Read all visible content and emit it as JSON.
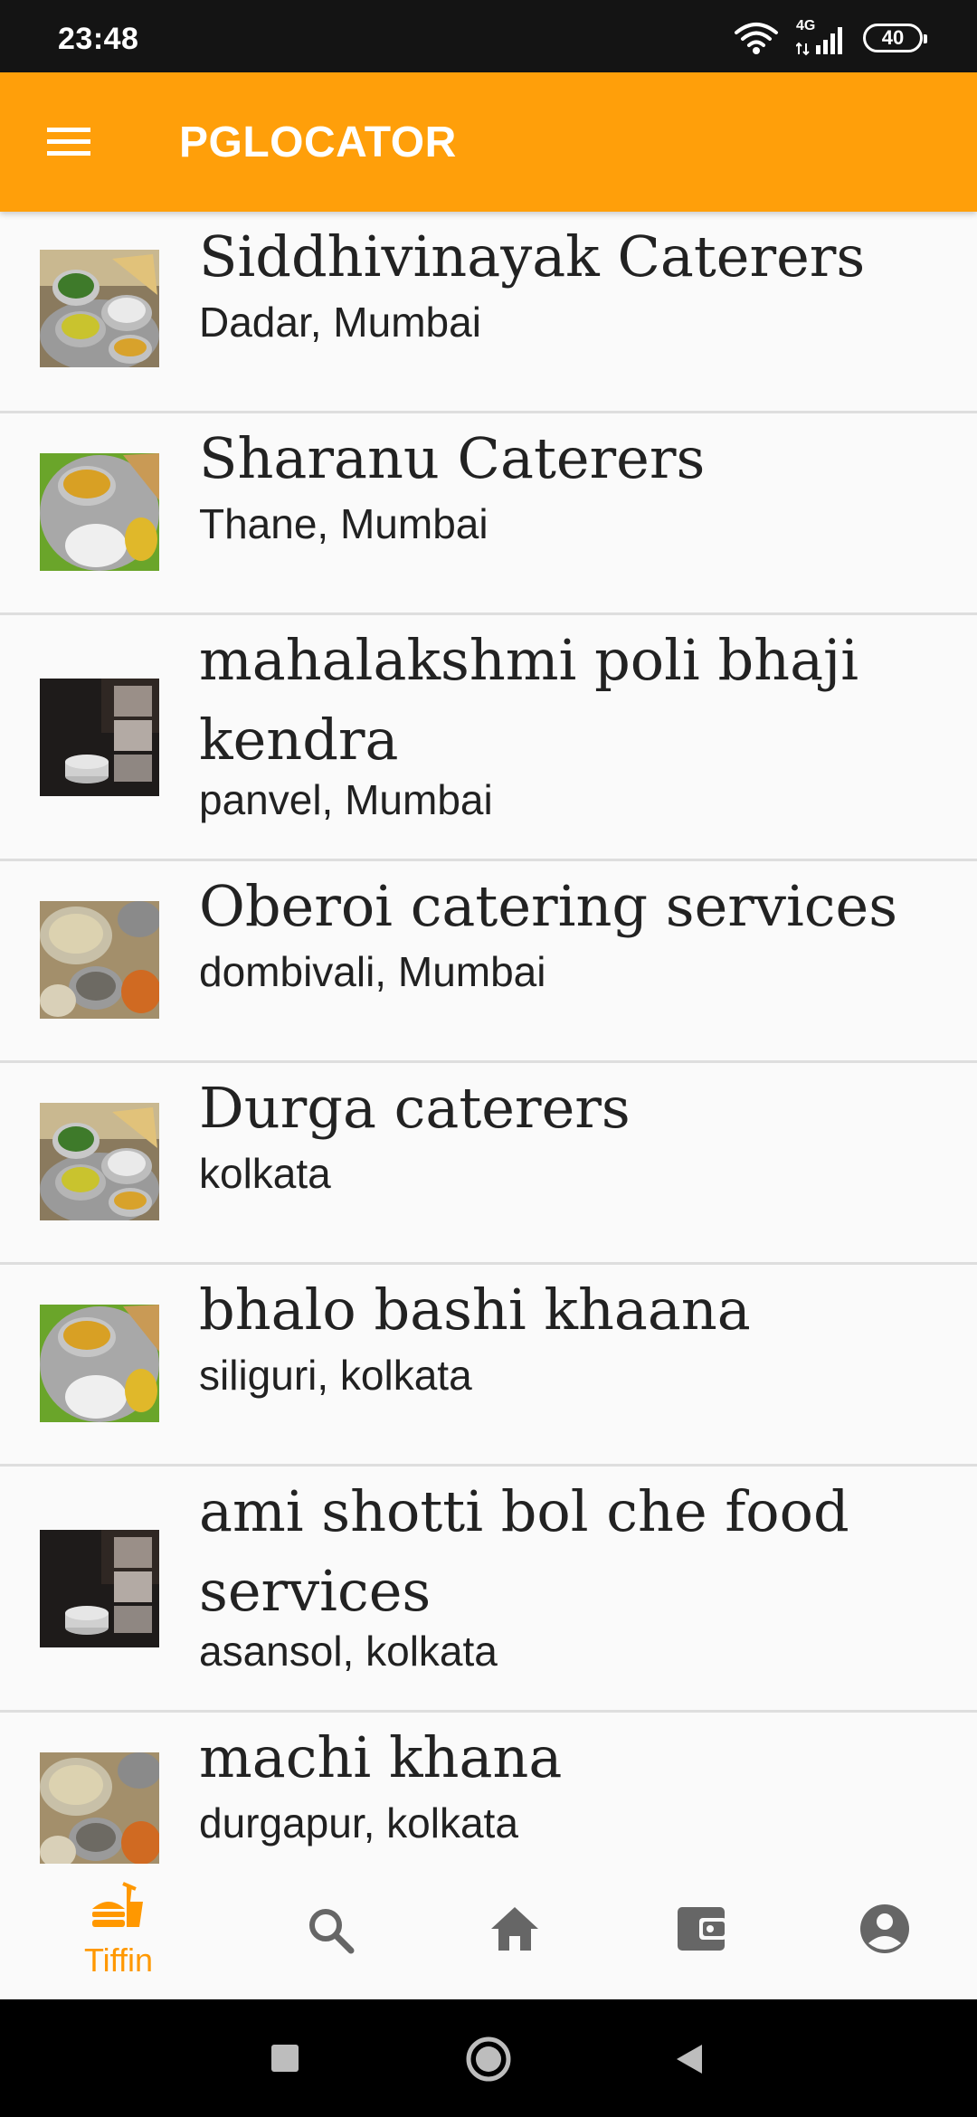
{
  "status_bar": {
    "time": "23:48",
    "network": "4G",
    "battery": "40"
  },
  "app_bar": {
    "title": "PGLOCATOR",
    "menu_icon": "hamburger-menu-icon"
  },
  "list": {
    "items": [
      {
        "name": "Siddhivinayak Caterers",
        "location": "Dadar, Mumbai",
        "thumbnail": "thali-plate"
      },
      {
        "name": "Sharanu Caterers",
        "location": "Thane, Mumbai",
        "thumbnail": "dal-rice-plate"
      },
      {
        "name": "mahalakshmi poli bhaji kendra",
        "location": "panvel, Mumbai",
        "thumbnail": "steel-tiffin"
      },
      {
        "name": "Oberoi catering services",
        "location": "dombivali, Mumbai",
        "thumbnail": "bowls-curry"
      },
      {
        "name": "Durga caterers",
        "location": "kolkata",
        "thumbnail": "thali-plate"
      },
      {
        "name": "bhalo bashi khaana",
        "location": "siliguri, kolkata",
        "thumbnail": "dal-rice-plate"
      },
      {
        "name": "ami shotti bol che food services",
        "location": "asansol, kolkata",
        "thumbnail": "steel-tiffin"
      },
      {
        "name": "machi khana",
        "location": "durgapur, kolkata",
        "thumbnail": "bowls-curry"
      }
    ]
  },
  "bottom_nav": {
    "items": [
      {
        "label": "Tiffin",
        "icon": "tiffin-burger-icon",
        "active": true
      },
      {
        "label": "",
        "icon": "search-icon",
        "active": false
      },
      {
        "label": "",
        "icon": "home-icon",
        "active": false
      },
      {
        "label": "",
        "icon": "wallet-icon",
        "active": false
      },
      {
        "label": "",
        "icon": "account-circle-icon",
        "active": false
      }
    ]
  },
  "colors": {
    "accent": "#ff9f0a",
    "active_nav": "#ff9800",
    "inactive_nav": "#666666"
  }
}
